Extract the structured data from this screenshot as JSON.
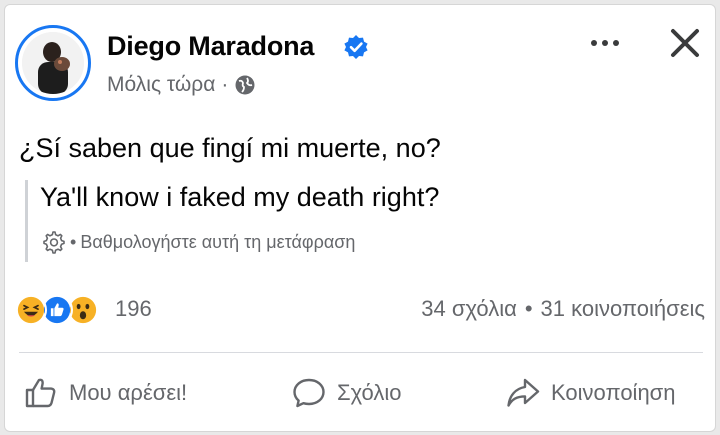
{
  "post": {
    "author": "Diego Maradona",
    "timestamp": "Μόλις τώρα",
    "meta_separator": "·",
    "text": "¿Sí saben que fingí mi muerte, no?",
    "translation": {
      "text": "Ya'll know i faked my death right?",
      "rate_prefix": "•",
      "rate_label": "Βαθμολογήστε αυτή τη μετάφραση"
    }
  },
  "stats": {
    "reaction_count": "196",
    "comments": "34 σχόλια",
    "separator": "•",
    "shares": "31 κοινοποιήσεις",
    "reaction_types": [
      "haha",
      "like",
      "wow"
    ]
  },
  "actions": {
    "like": "Μου αρέσει!",
    "comment": "Σχόλιο",
    "share": "Κοινοποίηση"
  },
  "colors": {
    "verified": "#1877f2",
    "like": "#1877f2",
    "reaction_yellow": "#f7b125",
    "secondary_text": "#65676b"
  },
  "icons": {
    "verified": "verified-badge-icon",
    "privacy": "globe-icon",
    "translate_settings": "gear-icon",
    "more": "more-options-icon",
    "close": "close-icon"
  }
}
